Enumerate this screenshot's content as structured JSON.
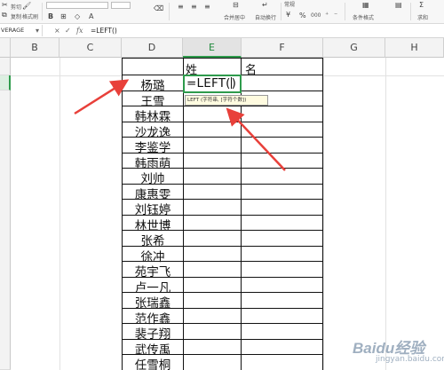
{
  "ribbon": {
    "cut_label": "剪切",
    "copy_label": "复制",
    "format_painter_label": "格式刷",
    "merge_center_label": "合并居中",
    "wrap_text_label": "自动换行",
    "number_format_label": "常规",
    "cond_format_label": "条件格式",
    "sum_label": "求和",
    "percent_glyph": "%",
    "thousands_glyph": "000",
    "font_name_glyph": "B"
  },
  "formula_bar": {
    "name_box": "VERAGE",
    "cancel_glyph": "×",
    "enter_glyph": "✓",
    "fx_label": "fx",
    "content": "=LEFT()"
  },
  "columns": [
    "B",
    "C",
    "D",
    "E",
    "F",
    "G",
    "H"
  ],
  "selected_column": "E",
  "header_row": {
    "col_e": "姓",
    "col_f": "名"
  },
  "active_cell": {
    "column": "E",
    "content": "=LEFT",
    "open_paren": "(",
    "close_paren": ")"
  },
  "tooltip": "LEFT (字符串, [字符个数])",
  "names": [
    "杨璐",
    "王雪",
    "韩林霖",
    "沙龙逸",
    "李鉴学",
    "韩雨萌",
    "刘帅",
    "康惠雯",
    "刘钰婷",
    "林世博",
    "张希",
    "徐冲",
    "苑宇飞",
    "卢一凡",
    "张瑞鑫",
    "范作鑫",
    "裴子翔",
    "武传禹",
    "任雪桐"
  ],
  "watermark": {
    "brand": "Baidu经验",
    "sub": "jingyan.baidu.com"
  },
  "colors": {
    "selection_green": "#2e9b4c",
    "arrow_red": "#e8403a",
    "tooltip_bg": "#fffbe0"
  }
}
